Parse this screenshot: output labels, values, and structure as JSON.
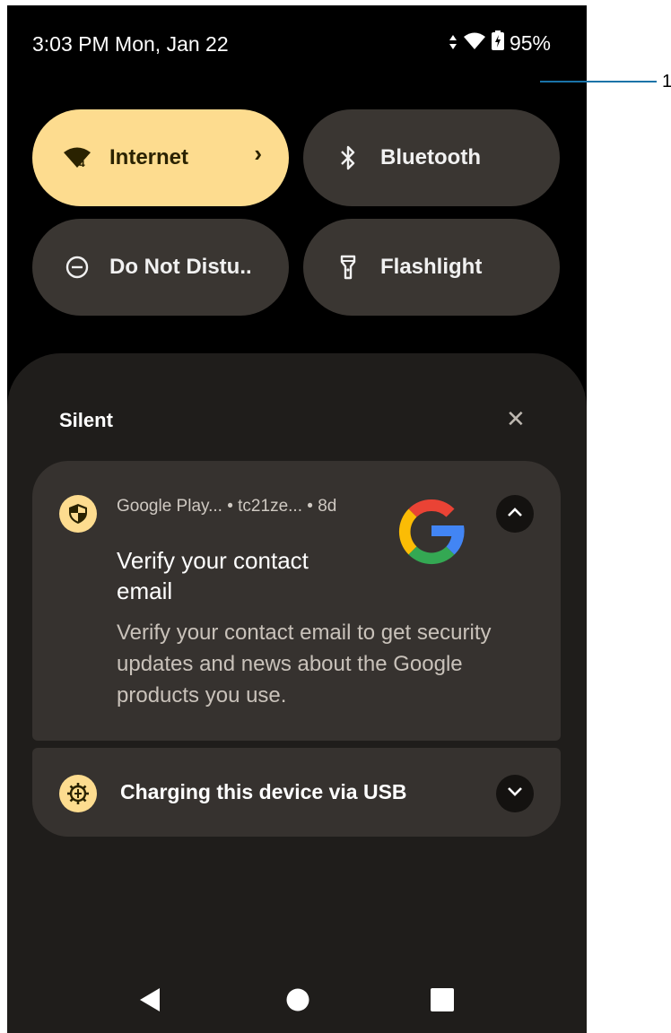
{
  "status_bar": {
    "time_date": "3:03 PM Mon, Jan 22",
    "battery": "95%",
    "icons": [
      "data-arrows-icon",
      "wifi-icon",
      "battery-charging-icon"
    ]
  },
  "callout": {
    "number": "1"
  },
  "quick_settings": {
    "tiles": [
      {
        "label": "Internet",
        "icon": "wifi-icon",
        "active": true
      },
      {
        "label": "Bluetooth",
        "icon": "bluetooth-icon",
        "active": false
      },
      {
        "label": "Do Not Distu..",
        "icon": "do-not-disturb-icon",
        "active": false
      },
      {
        "label": "Flashlight",
        "icon": "flashlight-icon",
        "active": false
      }
    ],
    "internet_chevron": "›"
  },
  "notifications": {
    "section_label": "Silent",
    "items": [
      {
        "app": "Google Play...",
        "account": "tc21ze...",
        "age": "8d",
        "title": "Verify your contact email",
        "body": "Verify your contact email to get security updates and news about the Google products you use.",
        "expanded": true
      },
      {
        "title": "Charging this device via USB",
        "expanded": false
      }
    ]
  },
  "colors": {
    "accent": "#fddc8f",
    "tile_off": "#3a3632",
    "shade": "#1f1d1b",
    "card": "#36322f"
  }
}
